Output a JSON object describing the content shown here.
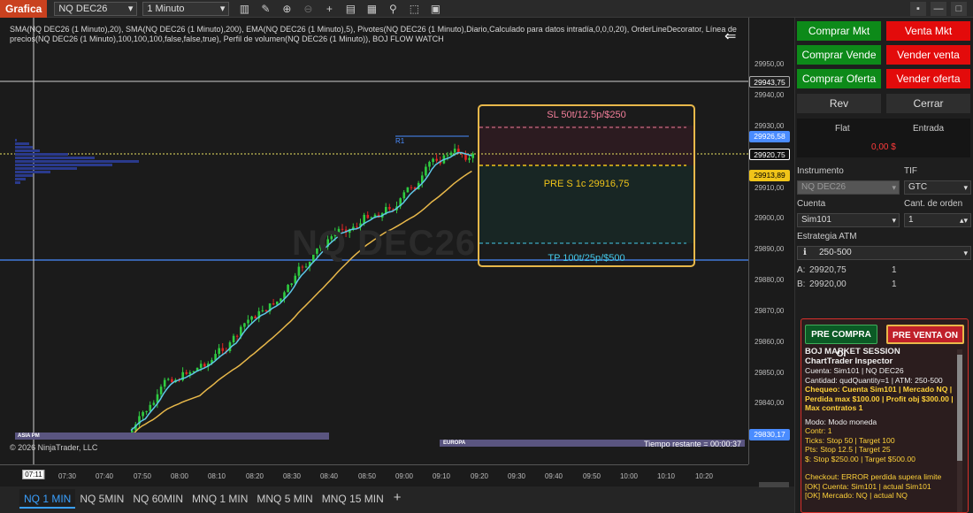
{
  "toolbar": {
    "title": "Grafica",
    "instrument": "NQ DEC26",
    "interval": "1 Minuto"
  },
  "chart": {
    "info_text": "SMA(NQ DEC26 (1 Minuto),20), SMA(NQ DEC26 (1 Minuto),200), EMA(NQ DEC26 (1 Minuto),5), Pivotes(NQ DEC26 (1 Minuto),Diario,Calculado para datos intradía,0,0,0,20), OrderLineDecorator, Línea de precios(NQ DEC26 (1 Minuto),100,100,100,false,false,true), Perfil de volumen(NQ DEC26 (1 Minuto)), BOJ FLOW WATCH",
    "watermark": "NQ DEC26",
    "f_label": "F",
    "order_box": {
      "sl": "SL 50t/12.5p/$250",
      "entry": "PRE S 1c 29916,75",
      "tp": "TP 100t/25p/$500"
    },
    "r1_label": "R1",
    "sessions": {
      "asia": "ASIA PM",
      "europe": "EUROPA"
    },
    "time_left": "Tiempo restante = 00:00:37",
    "copyright": "© 2026 NinjaTrader, LLC",
    "cursor_time": "07:11",
    "price_axis": [
      "29950,00",
      "29940,00",
      "29930,00",
      "29910,00",
      "29900,00",
      "29890,00",
      "29880,00",
      "29870,00",
      "29860,00",
      "29850,00",
      "29840,00"
    ],
    "price_tags": {
      "cursor": "29943,75",
      "r1": "29926,58",
      "last": "29920,75",
      "entry": "29913,89",
      "bottom": "29830,17"
    },
    "time_axis": [
      "07:30",
      "07:40",
      "07:50",
      "08:00",
      "08:10",
      "08:20",
      "08:30",
      "08:40",
      "08:50",
      "09:00",
      "09:10",
      "09:20",
      "09:30",
      "09:40",
      "09:50",
      "10:00",
      "10:10",
      "10:20"
    ]
  },
  "tabs": [
    "NQ 1 MIN",
    "NQ 5MIN",
    "NQ 60MIN",
    "MNQ 1 MIN",
    "MNQ 5 MIN",
    "MNQ 15 MIN"
  ],
  "panel": {
    "buy_mkt": "Comprar Mkt",
    "sell_mkt": "Venta Mkt",
    "buy_ask": "Comprar Vende",
    "sell_ask": "Vender venta",
    "buy_bid": "Comprar Oferta",
    "sell_bid": "Vender oferta",
    "rev": "Rev",
    "close": "Cerrar",
    "flat": "Flat",
    "entry_hdr": "Entrada",
    "pnl": "0,00 $",
    "instrument_label": "Instrumento",
    "instrument_value": "NQ DEC26",
    "tif_label": "TIF",
    "tif_value": "GTC",
    "account_label": "Cuenta",
    "account_value": "Sim101",
    "qty_label": "Cant. de orden",
    "qty_value": "1",
    "atm_label": "Estrategia ATM",
    "atm_value": "250-500",
    "ask_label": "A:",
    "ask_price": "29920,75",
    "ask_size": "1",
    "bid_label": "B:",
    "bid_price": "29920,00",
    "bid_size": "1"
  },
  "inspector": {
    "pre_buy": "PRE COMPRA OI",
    "pre_sell": "PRE VENTA ON",
    "title": "BOJ MARKET SESSION",
    "subtitle": "ChartTrader Inspector",
    "line1": "Cuenta: Sim101 | NQ DEC26",
    "line2": "Cantidad: qudQuantity=1 | ATM: 250-500",
    "check": "Chequeo: Cuenta Sim101 | Mercado NQ | Perdida max $100.00 | Profit obj $300.00 | Max contratos 1",
    "mode": "Modo: Modo moneda",
    "contr": "Contr: 1",
    "ticks": "Ticks: Stop 50 | Target 100",
    "pts": "Pts: Stop 12.5 | Target 25",
    "usd": "$: Stop $250.00 | Target $500.00",
    "checkout": "Checkout: ERROR perdida supera limite",
    "ok1": "[OK] Cuenta: Sim101 | actual Sim101",
    "ok2": "[OK] Mercado: NQ | actual NQ"
  },
  "colors": {
    "brand": "#c9411f",
    "buy": "#0d8a19",
    "sell": "#e30b0b",
    "order_box": "#e8b84a",
    "r1_tag": "#4a8cff",
    "entry_tag": "#f0c419"
  }
}
